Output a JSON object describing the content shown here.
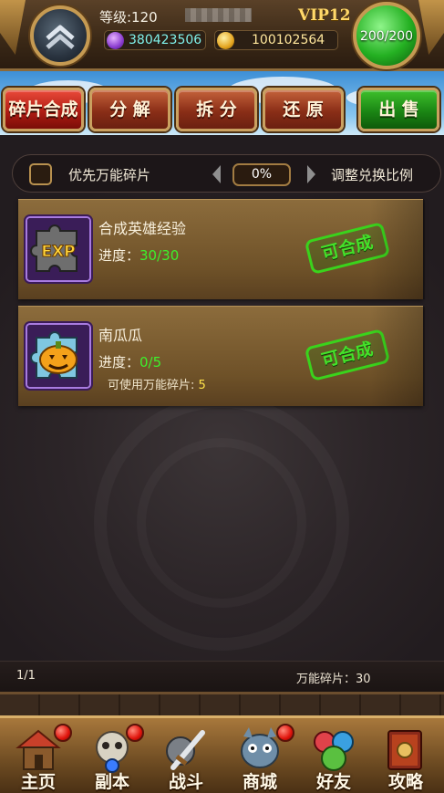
{
  "header": {
    "level_label": "等级:120",
    "vip_label": "VIP12",
    "gems": "380423506",
    "gold": "100102564",
    "energy": "200/200"
  },
  "tabs": [
    {
      "label": "碎片合成",
      "active": true
    },
    {
      "label": "分 解",
      "active": false
    },
    {
      "label": "拆 分",
      "active": false
    },
    {
      "label": "还 原",
      "active": false
    },
    {
      "label": "出 售",
      "active": false
    }
  ],
  "filter": {
    "priority_label": "优先万能碎片",
    "checked": false,
    "ratio_value": "0%",
    "ratio_label": "调整兑换比例"
  },
  "items": [
    {
      "title": "合成英雄经验",
      "progress_label": "进度：",
      "progress_value": "30/30",
      "stamp": "可合成",
      "icon": "exp-puzzle-icon"
    },
    {
      "title": "南瓜瓜",
      "progress_label": "进度：",
      "progress_value": "0/5",
      "extra_label": "可使用万能碎片: ",
      "extra_value": "5",
      "stamp": "可合成",
      "icon": "pumpkin-puzzle-icon"
    }
  ],
  "footer": {
    "page": "1/1",
    "wild_shards": "万能碎片：30"
  },
  "nav": [
    {
      "label": "主页",
      "icon": "house-icon",
      "badge": true
    },
    {
      "label": "副本",
      "icon": "skull-orb-icon",
      "badge": true
    },
    {
      "label": "战斗",
      "icon": "sword-shield-icon",
      "badge": false
    },
    {
      "label": "商城",
      "icon": "shop-monster-icon",
      "badge": true
    },
    {
      "label": "好友",
      "icon": "friends-icon",
      "badge": false
    },
    {
      "label": "攻略",
      "icon": "guide-book-icon",
      "badge": false
    }
  ],
  "colors": {
    "progress_green": "#3df02c",
    "stamp_green": "#44e22a",
    "gem_cyan": "#7ff0ea",
    "gold_yellow": "#ffe79c",
    "vip_gold": "#ffd86a"
  }
}
